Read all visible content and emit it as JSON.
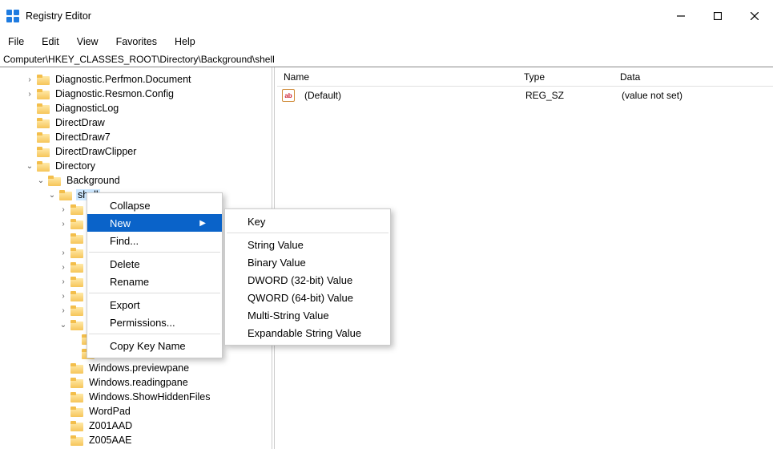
{
  "app_title": "Registry Editor",
  "menubar": [
    "File",
    "Edit",
    "View",
    "Favorites",
    "Help"
  ],
  "address": "Computer\\HKEY_CLASSES_ROOT\\Directory\\Background\\shell",
  "tree": [
    {
      "indent": 2,
      "exp": "closed",
      "label": "Diagnostic.Perfmon.Document"
    },
    {
      "indent": 2,
      "exp": "closed",
      "label": "Diagnostic.Resmon.Config"
    },
    {
      "indent": 2,
      "exp": "none",
      "label": "DiagnosticLog"
    },
    {
      "indent": 2,
      "exp": "none",
      "label": "DirectDraw"
    },
    {
      "indent": 2,
      "exp": "none",
      "label": "DirectDraw7"
    },
    {
      "indent": 2,
      "exp": "none",
      "label": "DirectDrawClipper"
    },
    {
      "indent": 2,
      "exp": "open",
      "label": "Directory"
    },
    {
      "indent": 3,
      "exp": "open",
      "label": "Background"
    },
    {
      "indent": 4,
      "exp": "open",
      "label": "shell",
      "selected": true
    },
    {
      "indent": 5,
      "exp": "closed",
      "label": ""
    },
    {
      "indent": 5,
      "exp": "closed",
      "label": ""
    },
    {
      "indent": 5,
      "exp": "none",
      "label": ""
    },
    {
      "indent": 5,
      "exp": "closed",
      "label": ""
    },
    {
      "indent": 5,
      "exp": "closed",
      "label": ""
    },
    {
      "indent": 5,
      "exp": "closed",
      "label": ""
    },
    {
      "indent": 5,
      "exp": "closed",
      "label": ""
    },
    {
      "indent": 5,
      "exp": "closed",
      "label": ""
    },
    {
      "indent": 5,
      "exp": "open",
      "label": ""
    },
    {
      "indent": 6,
      "exp": "none",
      "label": ""
    },
    {
      "indent": 6,
      "exp": "none",
      "label": ""
    },
    {
      "indent": 5,
      "exp": "none",
      "label": "Windows.previewpane"
    },
    {
      "indent": 5,
      "exp": "none",
      "label": "Windows.readingpane"
    },
    {
      "indent": 5,
      "exp": "none",
      "label": "Windows.ShowHiddenFiles"
    },
    {
      "indent": 5,
      "exp": "none",
      "label": "WordPad"
    },
    {
      "indent": 5,
      "exp": "none",
      "label": "Z001AAD"
    },
    {
      "indent": 5,
      "exp": "none",
      "label": "Z005AAE"
    }
  ],
  "columns": {
    "name": "Name",
    "type": "Type",
    "data": "Data"
  },
  "rows": [
    {
      "name": "(Default)",
      "type": "REG_SZ",
      "data": "(value not set)"
    }
  ],
  "ctx": {
    "collapse": "Collapse",
    "new": "New",
    "find": "Find...",
    "delete": "Delete",
    "rename": "Rename",
    "export": "Export",
    "permissions": "Permissions...",
    "copykey": "Copy Key Name"
  },
  "submenu": [
    "Key",
    "---",
    "String Value",
    "Binary Value",
    "DWORD (32-bit) Value",
    "QWORD (64-bit) Value",
    "Multi-String Value",
    "Expandable String Value"
  ]
}
